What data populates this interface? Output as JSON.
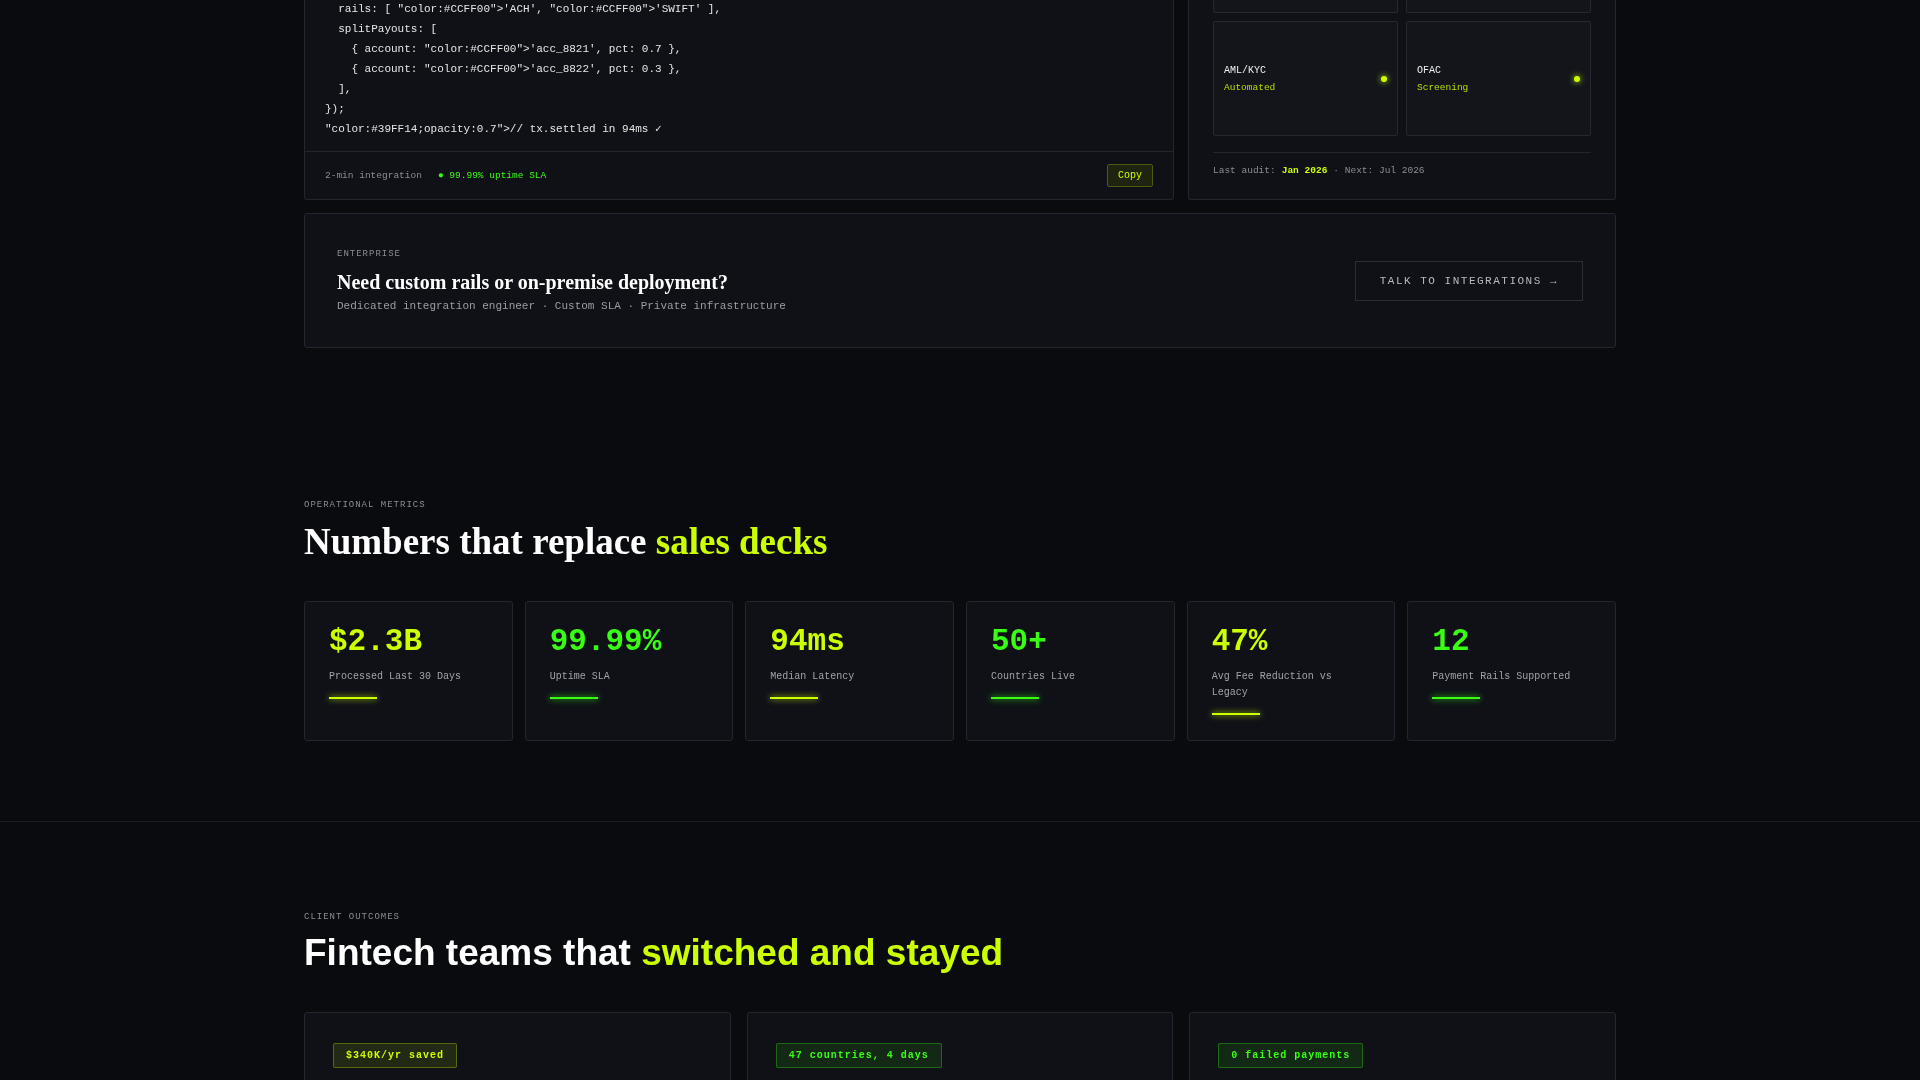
{
  "integration": {
    "code_lines": [
      "  rails: [ \"color:#CCFF00\">'ACH', \"color:#CCFF00\">'SWIFT' ],",
      "  splitPayouts: [",
      "    { account: \"color:#CCFF00\">'acc_8821', pct: 0.7 },",
      "    { account: \"color:#CCFF00\">'acc_8822', pct: 0.3 },",
      "  ],",
      "});",
      "\"color:#39FF14;opacity:0.7\">// tx.settled in 94ms ✓"
    ],
    "footer_note": "2-min integration",
    "sla": "● 99.99% uptime SLA",
    "copy_button": "Copy"
  },
  "compliance": {
    "tiles": [
      {
        "name": "AML/KYC",
        "status": "Automated",
        "color": "#ccff00"
      },
      {
        "name": "OFAC",
        "status": "Screening",
        "color": "#ccff00"
      }
    ],
    "audit_label": "Last audit:",
    "audit_date": "Jan 2026",
    "next": "· Next: Jul 2026"
  },
  "enterprise": {
    "eyebrow": "ENTERPRISE",
    "title": "Need custom rails or on-premise deployment?",
    "subtitle": "Dedicated integration engineer · Custom SLA · Private infrastructure",
    "button": "TALK TO INTEGRATIONS →"
  },
  "metrics": {
    "eyebrow": "OPERATIONAL METRICS",
    "title": "Numbers that replace",
    "title_accent": "sales decks",
    "items": [
      {
        "value": "$2.3B",
        "label": "Processed Last 30 Days",
        "color": "#ccff00"
      },
      {
        "value": "99.99%",
        "label": "Uptime SLA",
        "color": "#39ff14"
      },
      {
        "value": "94ms",
        "label": "Median Latency",
        "color": "#ccff00"
      },
      {
        "value": "50+",
        "label": "Countries Live",
        "color": "#39ff14"
      },
      {
        "value": "47%",
        "label": "Avg Fee Reduction vs Legacy",
        "color": "#ccff00"
      },
      {
        "value": "12",
        "label": "Payment Rails Supported",
        "color": "#39ff14"
      }
    ]
  },
  "outcomes": {
    "eyebrow": "CLIENT OUTCOMES",
    "title": "Fintech teams that",
    "title_accent": "switched and stayed",
    "cards": [
      {
        "badge": "$340K/yr saved",
        "color": "#ccff00"
      },
      {
        "badge": "47 countries, 4 days",
        "color": "#39ff14"
      },
      {
        "badge": "0 failed payments",
        "color": "#39ff14"
      }
    ]
  }
}
